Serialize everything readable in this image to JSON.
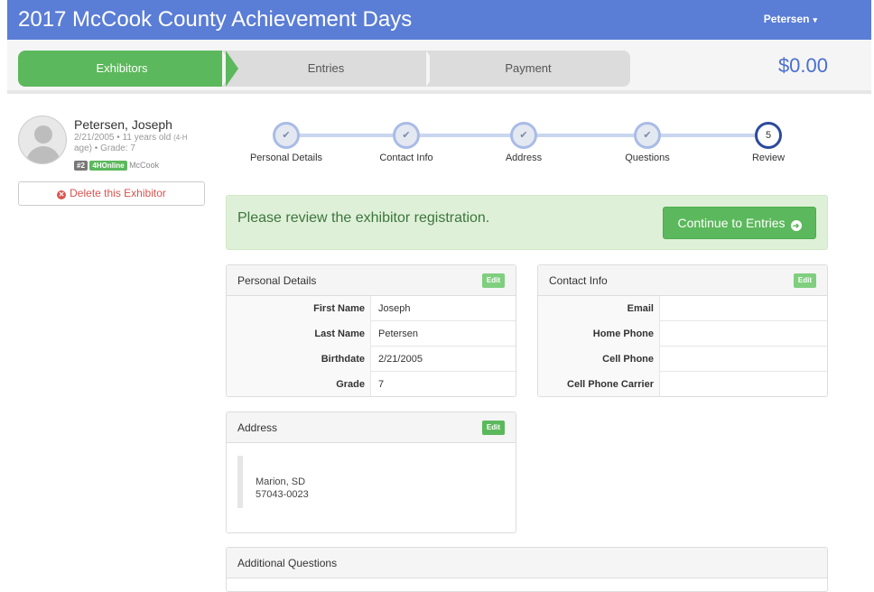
{
  "header": {
    "title": "2017 McCook County Achievement Days",
    "user": "Petersen",
    "user_caret": "▾"
  },
  "wizard": {
    "steps": [
      {
        "label": "Exhibitors"
      },
      {
        "label": "Entries"
      },
      {
        "label": "Payment"
      }
    ],
    "total": "$0.00"
  },
  "profile": {
    "name": "Petersen, Joseph",
    "meta_main": "2/21/2005 • 11 years old",
    "meta_small": "(4-H",
    "meta_line2": "age) • Grade: 7",
    "tag_number": "#2",
    "tag_source": "4HOnline",
    "county": "McCook",
    "delete_label": "Delete this Exhibitor",
    "delete_icon_glyph": "✕"
  },
  "progress": {
    "steps": [
      {
        "label": "Personal Details",
        "glyph": "✔"
      },
      {
        "label": "Contact Info",
        "glyph": "✔"
      },
      {
        "label": "Address",
        "glyph": "✔"
      },
      {
        "label": "Questions",
        "glyph": "✔"
      },
      {
        "label": "Review",
        "glyph": "5"
      }
    ]
  },
  "alert": {
    "message": "Please review the exhibitor registration.",
    "button": "Continue to Entries",
    "button_icon": "➜"
  },
  "personal": {
    "title": "Personal Details",
    "edit": "Edit",
    "rows": [
      {
        "k": "First Name",
        "v": "Joseph"
      },
      {
        "k": "Last Name",
        "v": "Petersen"
      },
      {
        "k": "Birthdate",
        "v": "2/21/2005"
      },
      {
        "k": "Grade",
        "v": "7"
      }
    ]
  },
  "contact": {
    "title": "Contact Info",
    "edit": "Edit",
    "rows": [
      {
        "k": "Email",
        "v": ""
      },
      {
        "k": "Home Phone",
        "v": ""
      },
      {
        "k": "Cell Phone",
        "v": ""
      },
      {
        "k": "Cell Phone Carrier",
        "v": ""
      }
    ]
  },
  "address": {
    "title": "Address",
    "edit": "Edit",
    "line1": "Marion, SD",
    "line2": "57043-0023"
  },
  "questions": {
    "title": "Additional Questions"
  },
  "colors": {
    "header": "#5a7dd6",
    "success": "#5cb85c",
    "danger": "#d9534f",
    "total": "#4a6fd0"
  }
}
